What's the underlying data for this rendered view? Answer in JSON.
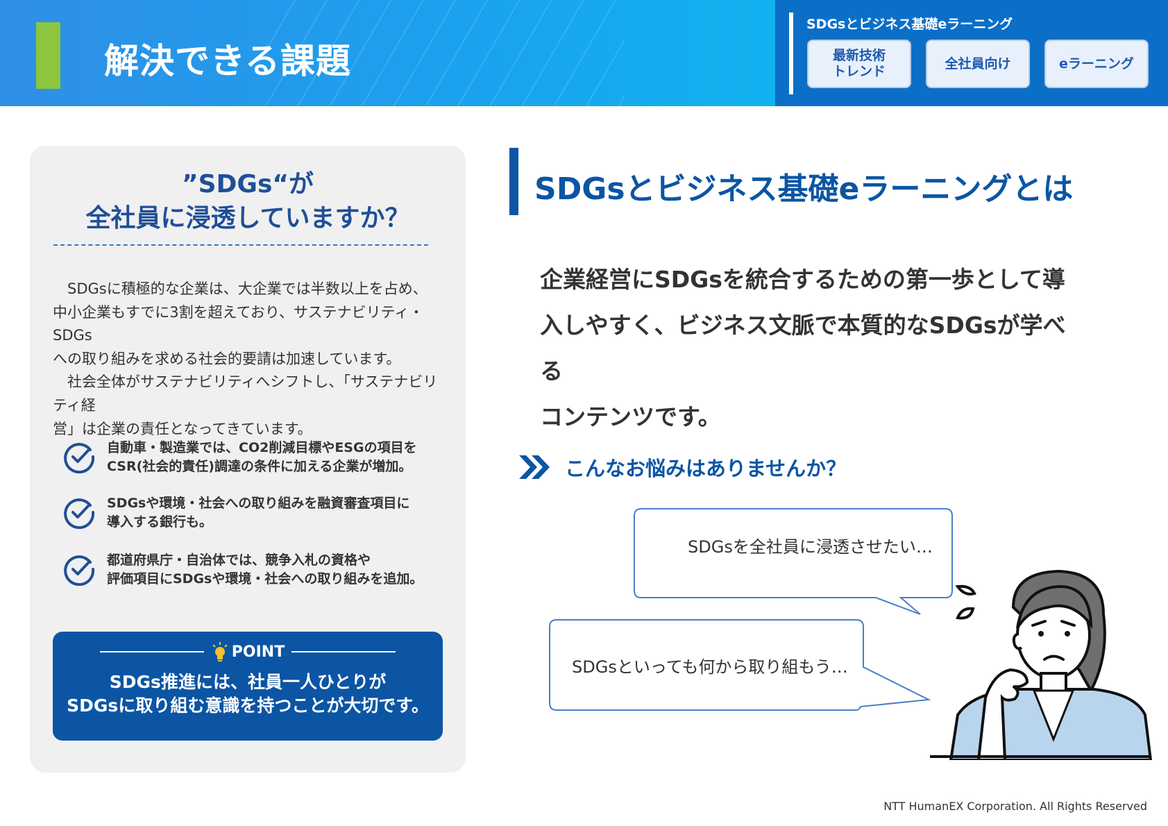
{
  "header": {
    "title": "解決できる課題",
    "brand": "SDGsとビジネス基礎eラーニング",
    "tags": [
      "最新技術\nトレンド",
      "全社員向け",
      "eラーニング"
    ]
  },
  "left": {
    "heading": "”SDGs“が\n全社員に浸透していますか？",
    "intro": "　SDGsに積極的な企業は、大企業では半数以上を占め、\n中小企業もすでに3割を超えており、サステナビリティ・SDGs\nへの取り組みを求める社会的要請は加速しています。\n　社会全体がサステナビリティへシフトし、「サステナビリティ経\n営」は企業の責任となってきています。",
    "checks": [
      "自動車・製造業では、CO2削減目標やESGの項目を\nCSR(社会的責任)調達の条件に加える企業が増加。",
      "SDGsや環境・社会への取り組みを融資審査項目に\n導入する銀行も。",
      "都道府県庁・自治体では、競争入札の資格や\n評価項目にSDGsや環境・社会への取り組みを追加。"
    ],
    "point_label": "POINT",
    "point_message": "SDGs推進には、社員一人ひとりが\nSDGsに取り組む意識を持つことが大切です。"
  },
  "right": {
    "section_title": "SDGsとビジネス基礎eラーニングとは",
    "description": "企業経営にSDGsを統合するための第一歩として導\n入しやすく、ビジネス文脈で本質的なSDGsが学べる\nコンテンツです。",
    "question": "こんなお悩みはありませんか？",
    "bubble1": "SDGsを全社員に浸透させたい…",
    "bubble2": "SDGsといっても何から取り組もう…"
  },
  "footer": "NTT HumanEX Corporation. All Rights Reserved",
  "colors": {
    "accent_blue": "#0b55a4",
    "green": "#8cc63f",
    "header_blue": "#0b6fc8"
  }
}
